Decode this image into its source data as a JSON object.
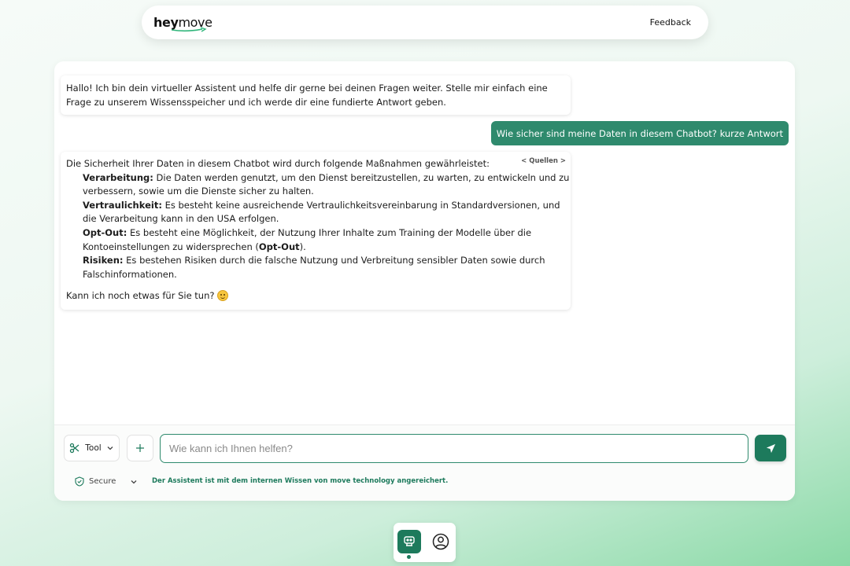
{
  "header": {
    "logo_bold": "hey",
    "logo_regular": "move",
    "feedback_label": "Feedback"
  },
  "chat": {
    "greeting_lines": [
      "Hallo! Ich bin dein virtueller Assistent und helfe dir gerne bei deinen Fragen weiter. Stelle mir einfach eine",
      "Frage zu unserem Wissensspeicher und ich werde dir eine fundierte Antwort geben."
    ],
    "user_message": "Wie sicher sind meine Daten in diesem Chatbot? kurze Antwort",
    "sources_label": "< Quellen >",
    "answer": {
      "intro": "Die Sicherheit Ihrer Daten in diesem Chatbot wird durch folgende Maßnahmen gewährleistet:",
      "b1_term": "Verarbeitung:",
      "b1_line1": " Die Daten werden genutzt, um den Dienst bereitzustellen, zu warten, zu entwickeln und zu",
      "b1_line2": "verbessern, sowie um die Dienste sicher zu halten.",
      "b2_term": "Vertraulichkeit:",
      "b2_line1": " Es besteht keine ausreichende Vertraulichkeitsvereinbarung in Standardversionen, und",
      "b2_line2": "die Verarbeitung kann in den USA erfolgen.",
      "b3_term": "Opt-Out:",
      "b3_line1": " Es besteht eine Möglichkeit, der Nutzung Ihrer Inhalte zum Training der Modelle über die",
      "b3_line2a": "Kontoeinstellungen zu widersprechen (",
      "b3_line2b": "Opt-Out",
      "b3_line2c": ").",
      "b4_term": "Risiken:",
      "b4_line1": " Es bestehen Risiken durch die falsche Nutzung und Verbreitung sensibler Daten sowie durch",
      "b4_line2": "Falschinformationen.",
      "closing": "Kann ich noch etwas für Sie tun? "
    }
  },
  "composer": {
    "tool_label": "Tool",
    "placeholder": "Wie kann ich Ihnen helfen?",
    "input_value": "",
    "secure_label": "Secure",
    "info_text": "Der Assistent ist mit dem internen Wissen von move technology angereichert."
  },
  "icons": {
    "tool": "scissors-icon",
    "tool_dropdown": "chevron-down-icon",
    "add": "plus-icon",
    "send": "send-icon",
    "secure": "shield-check-icon",
    "secure_dropdown": "chevron-down-icon",
    "nav_assistant": "robot-icon",
    "nav_profile": "user-circle-icon",
    "emoji": "smiling-face-emoji"
  },
  "colors": {
    "accent": "#1d7a5c",
    "user_bubble": "#2f8a6d",
    "info_text": "#1d7a5c"
  }
}
